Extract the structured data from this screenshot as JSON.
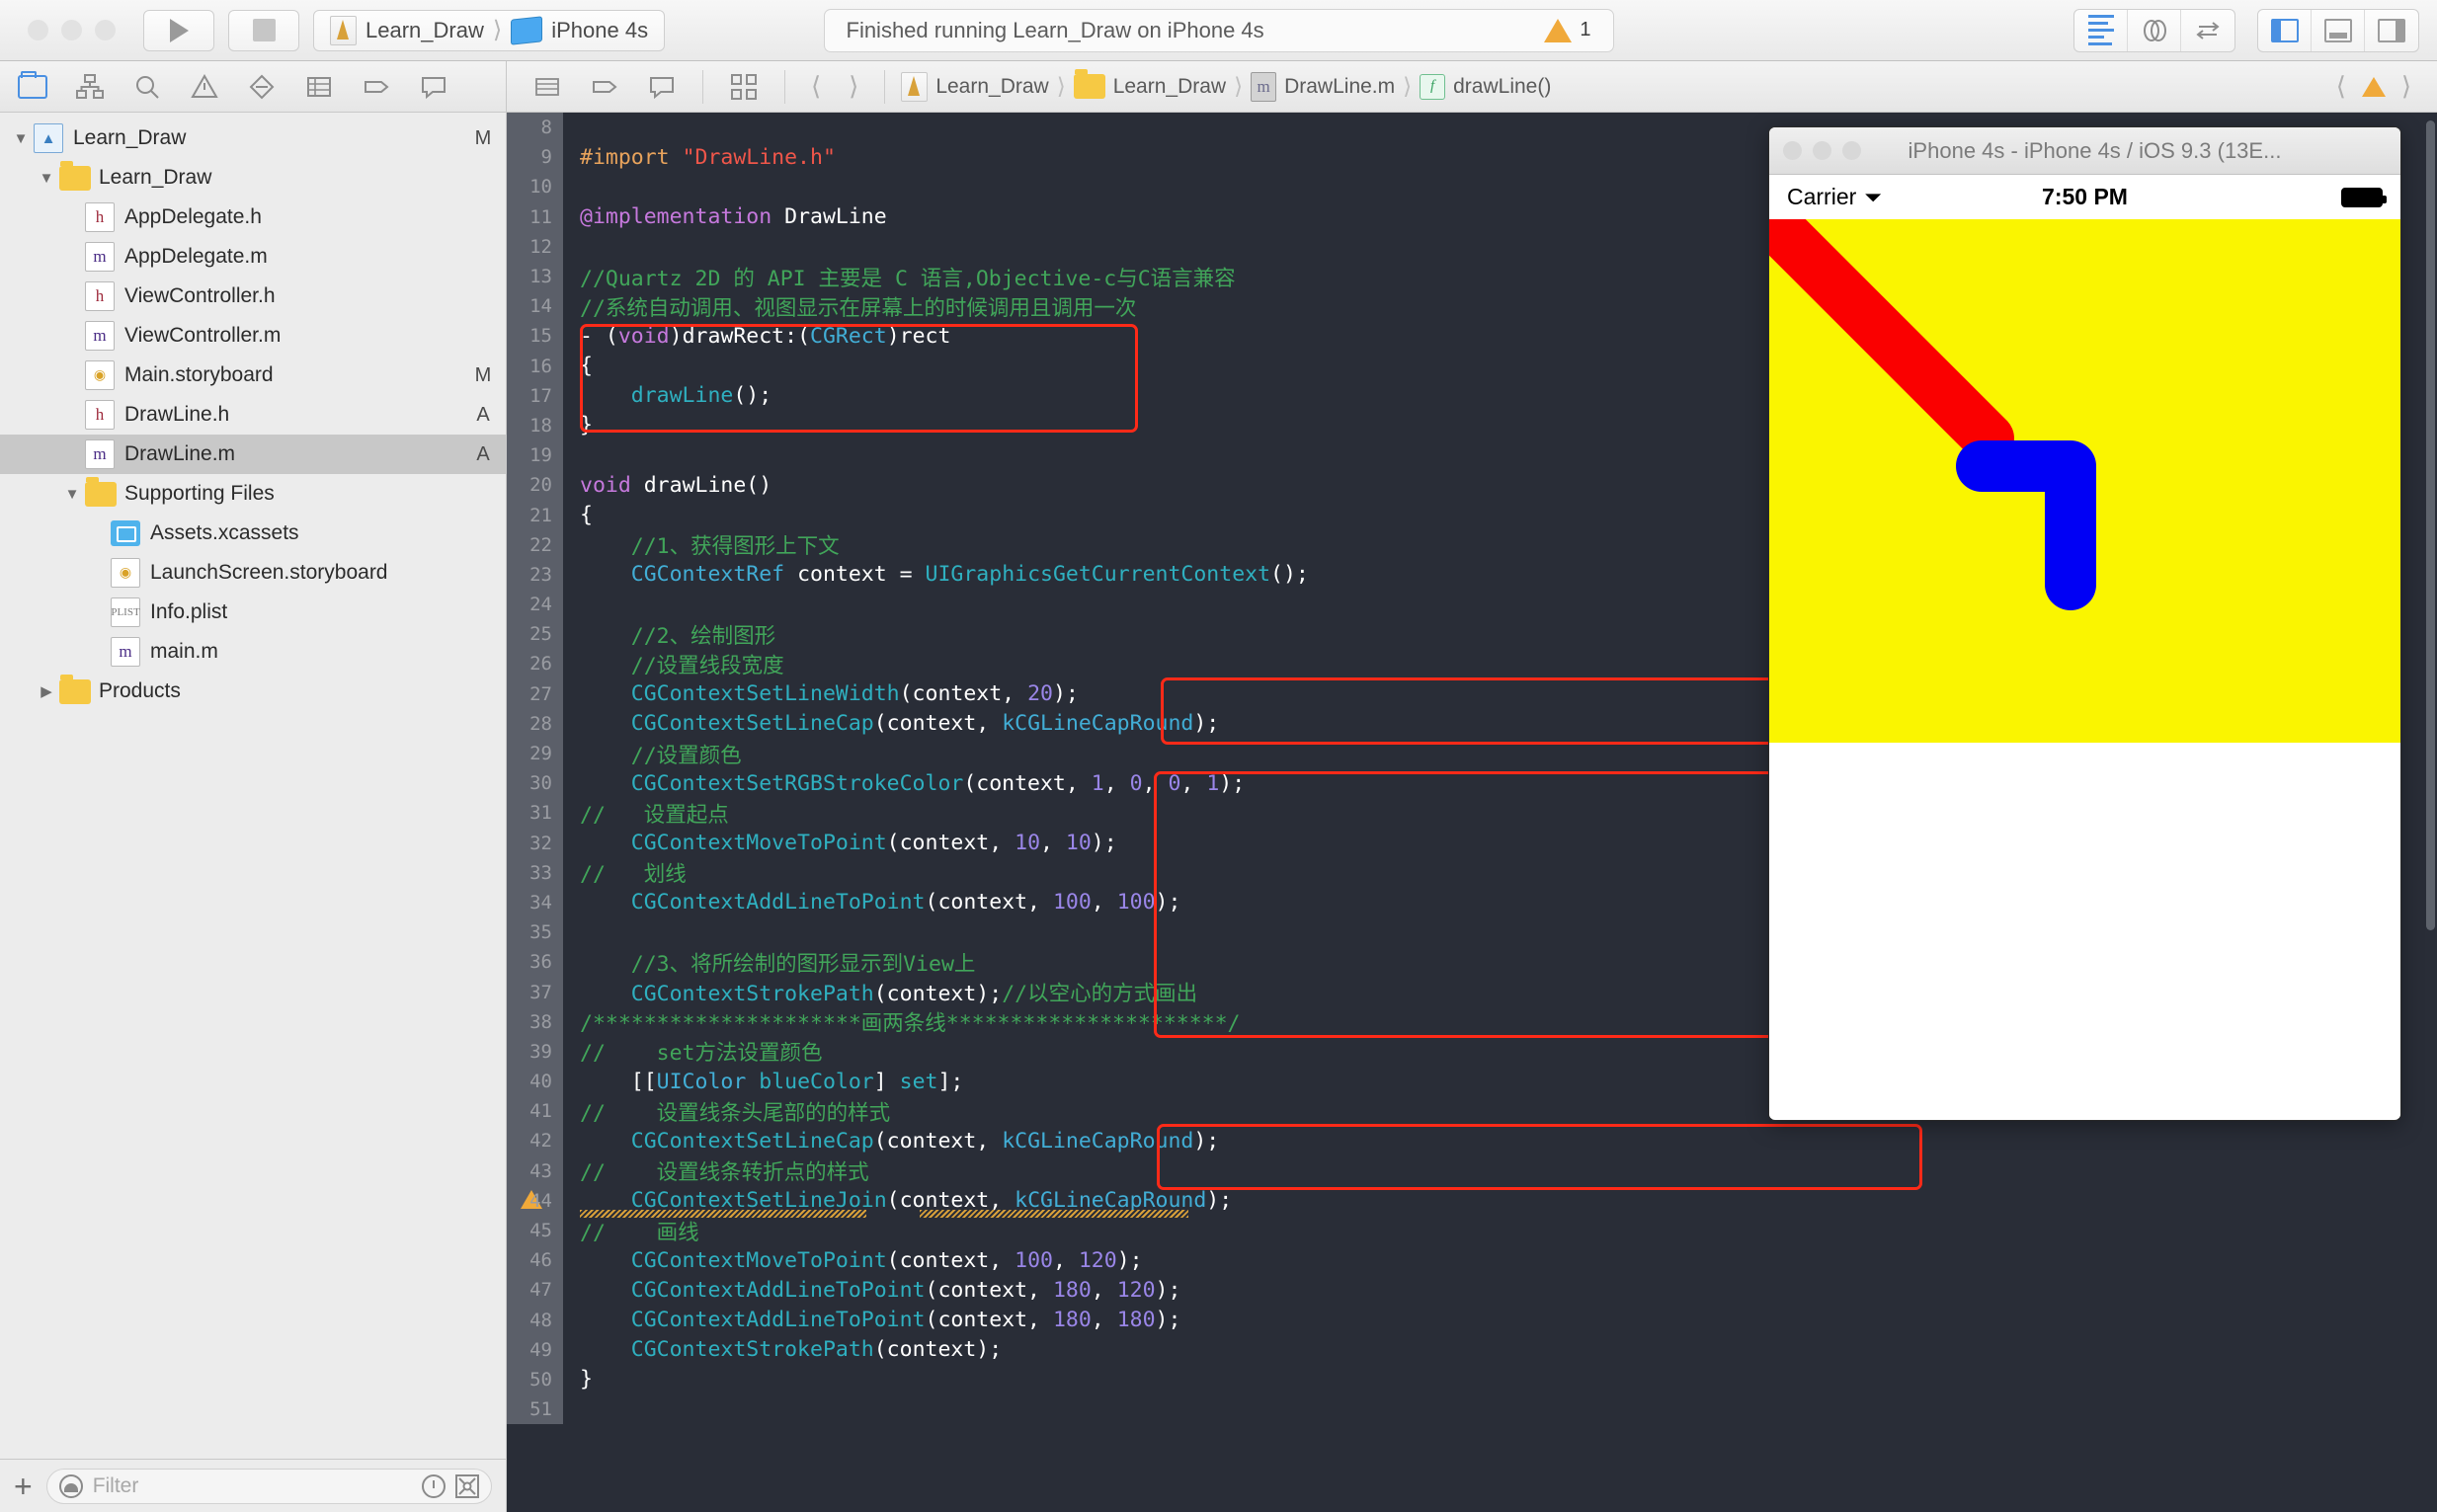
{
  "toolbar": {
    "run_label": "run-button",
    "stop_label": "stop-button",
    "scheme_project": "Learn_Draw",
    "scheme_device": "iPhone 4s",
    "status_text": "Finished running Learn_Draw on iPhone 4s",
    "warning_count": "1"
  },
  "navigator": {
    "filter_placeholder": "Filter",
    "tree": [
      {
        "label": "Learn_Draw",
        "indent": 0,
        "icon": "project-icon",
        "twisty": "open",
        "status": "M"
      },
      {
        "label": "Learn_Draw",
        "indent": 1,
        "icon": "folder-icon",
        "twisty": "open",
        "status": ""
      },
      {
        "label": "AppDelegate.h",
        "indent": 2,
        "icon": "header-file-icon",
        "twisty": "",
        "status": ""
      },
      {
        "label": "AppDelegate.m",
        "indent": 2,
        "icon": "source-file-icon",
        "twisty": "",
        "status": ""
      },
      {
        "label": "ViewController.h",
        "indent": 2,
        "icon": "header-file-icon",
        "twisty": "",
        "status": ""
      },
      {
        "label": "ViewController.m",
        "indent": 2,
        "icon": "source-file-icon",
        "twisty": "",
        "status": ""
      },
      {
        "label": "Main.storyboard",
        "indent": 2,
        "icon": "storyboard-icon",
        "twisty": "",
        "status": "M"
      },
      {
        "label": "DrawLine.h",
        "indent": 2,
        "icon": "header-file-icon",
        "twisty": "",
        "status": "A"
      },
      {
        "label": "DrawLine.m",
        "indent": 2,
        "icon": "source-file-icon",
        "twisty": "",
        "status": "A",
        "selected": true
      },
      {
        "label": "Supporting Files",
        "indent": 2,
        "icon": "folder-icon",
        "twisty": "open",
        "status": ""
      },
      {
        "label": "Assets.xcassets",
        "indent": 3,
        "icon": "assets-icon",
        "twisty": "",
        "status": ""
      },
      {
        "label": "LaunchScreen.storyboard",
        "indent": 3,
        "icon": "storyboard-icon",
        "twisty": "",
        "status": ""
      },
      {
        "label": "Info.plist",
        "indent": 3,
        "icon": "plist-icon",
        "twisty": "",
        "status": ""
      },
      {
        "label": "main.m",
        "indent": 3,
        "icon": "source-file-icon",
        "twisty": "",
        "status": ""
      },
      {
        "label": "Products",
        "indent": 1,
        "icon": "folder-icon",
        "twisty": "closed",
        "status": ""
      }
    ]
  },
  "jumpbar": {
    "crumbs": [
      "Learn_Draw",
      "Learn_Draw",
      "DrawLine.m",
      "drawLine()"
    ]
  },
  "editor": {
    "lines": [
      {
        "n": "8",
        "html": ""
      },
      {
        "n": "9",
        "html": "<span class='pre'>#import</span> <span class='str'>\"DrawLine.h\"</span>"
      },
      {
        "n": "10",
        "html": ""
      },
      {
        "n": "11",
        "html": "<span class='kw'>@implementation</span> <span class='cls'>DrawLine</span>"
      },
      {
        "n": "12",
        "html": ""
      },
      {
        "n": "13",
        "html": "<span class='cm'>//Quartz 2D 的 API 主要是 C 语言,Objective-c与C语言兼容</span>"
      },
      {
        "n": "14",
        "html": "<span class='cm'>//系统自动调用、视图显示在屏幕上的时候调用且调用一次</span>"
      },
      {
        "n": "15",
        "html": "<span class='pl'>- (</span><span class='kw'>void</span><span class='pl'>)drawRect:(</span><span class='ty'>CGRect</span><span class='pl'>)rect</span>"
      },
      {
        "n": "16",
        "html": "<span class='pl'>{</span>"
      },
      {
        "n": "17",
        "html": "    <span class='fn'>drawLine</span><span class='pl'>();</span>"
      },
      {
        "n": "18",
        "html": "<span class='pl'>}</span>"
      },
      {
        "n": "19",
        "html": ""
      },
      {
        "n": "20",
        "html": "<span class='kw'>void</span> <span class='pl'>drawLine()</span>"
      },
      {
        "n": "21",
        "html": "<span class='pl'>{</span>"
      },
      {
        "n": "22",
        "html": "    <span class='cm'>//1、获得图形上下文</span>"
      },
      {
        "n": "23",
        "html": "    <span class='ty'>CGContextRef</span> <span class='pl'>context = </span><span class='fn'>UIGraphicsGetCurrentContext</span><span class='pl'>();</span>"
      },
      {
        "n": "24",
        "html": ""
      },
      {
        "n": "25",
        "html": "    <span class='cm'>//2、绘制图形</span>"
      },
      {
        "n": "26",
        "html": "    <span class='cm'>//设置线段宽度</span>"
      },
      {
        "n": "27",
        "html": "    <span class='fn'>CGContextSetLineWidth</span><span class='pl'>(context, </span><span class='num'>20</span><span class='pl'>);</span>"
      },
      {
        "n": "28",
        "html": "    <span class='fn'>CGContextSetLineCap</span><span class='pl'>(context, </span><span class='ty'>kCGLineCapRound</span><span class='pl'>);</span>"
      },
      {
        "n": "29",
        "html": "    <span class='cm'>//设置颜色</span>"
      },
      {
        "n": "30",
        "html": "    <span class='fn'>CGContextSetRGBStrokeColor</span><span class='pl'>(context, </span><span class='num'>1</span><span class='pl'>, </span><span class='num'>0</span><span class='pl'>, </span><span class='num'>0</span><span class='pl'>, </span><span class='num'>1</span><span class='pl'>);</span>"
      },
      {
        "n": "31",
        "html": "<span class='cm'>//   设置起点</span>"
      },
      {
        "n": "32",
        "html": "    <span class='fn'>CGContextMoveToPoint</span><span class='pl'>(context, </span><span class='num'>10</span><span class='pl'>, </span><span class='num'>10</span><span class='pl'>);</span>"
      },
      {
        "n": "33",
        "html": "<span class='cm'>//   划线</span>"
      },
      {
        "n": "34",
        "html": "    <span class='fn'>CGContextAddLineToPoint</span><span class='pl'>(context, </span><span class='num'>100</span><span class='pl'>, </span><span class='num'>100</span><span class='pl'>);</span>"
      },
      {
        "n": "35",
        "html": ""
      },
      {
        "n": "36",
        "html": "    <span class='cm'>//3、将所绘制的图形显示到View上</span>"
      },
      {
        "n": "37",
        "html": "    <span class='fn'>CGContextStrokePath</span><span class='pl'>(context);</span><span class='cm'>//以空心的方式画出</span>"
      },
      {
        "n": "38",
        "html": "<span class='cm'>/*********************画两条线**********************/</span>"
      },
      {
        "n": "39",
        "html": "<span class='cm'>//    set方法设置颜色</span>"
      },
      {
        "n": "40",
        "html": "    <span class='pl'>[[</span><span class='ty'>UIColor</span> <span class='fn'>blueColor</span><span class='pl'>] </span><span class='fn'>set</span><span class='pl'>];</span>"
      },
      {
        "n": "41",
        "html": "<span class='cm'>//    设置线条头尾部的的样式</span>"
      },
      {
        "n": "42",
        "html": "    <span class='fn'>CGContextSetLineCap</span><span class='pl'>(context, </span><span class='ty'>kCGLineCapRound</span><span class='pl'>);</span>"
      },
      {
        "n": "43",
        "html": "<span class='cm'>//    设置线条转折点的样式</span>"
      },
      {
        "n": "44",
        "html": "    <span class='fn'>CGContextSetLineJoin</span><span class='pl'>(context, </span><span class='ty'>kCGLineCapRound</span><span class='pl'>);</span>",
        "warning": true
      },
      {
        "n": "45",
        "html": "<span class='cm'>//    画线</span>"
      },
      {
        "n": "46",
        "html": "    <span class='fn'>CGContextMoveToPoint</span><span class='pl'>(context, </span><span class='num'>100</span><span class='pl'>, </span><span class='num'>120</span><span class='pl'>);</span>"
      },
      {
        "n": "47",
        "html": "    <span class='fn'>CGContextAddLineToPoint</span><span class='pl'>(context, </span><span class='num'>180</span><span class='pl'>, </span><span class='num'>120</span><span class='pl'>);</span>"
      },
      {
        "n": "48",
        "html": "    <span class='fn'>CGContextAddLineToPoint</span><span class='pl'>(context, </span><span class='num'>180</span><span class='pl'>, </span><span class='num'>180</span><span class='pl'>);</span>"
      },
      {
        "n": "49",
        "html": "    <span class='fn'>CGContextStrokePath</span><span class='pl'>(context);</span>"
      },
      {
        "n": "50",
        "html": "<span class='pl'>}</span>"
      },
      {
        "n": "51",
        "html": ""
      }
    ]
  },
  "simulator": {
    "window_title": "iPhone 4s - iPhone 4s / iOS 9.3 (13E...",
    "carrier": "Carrier",
    "time": "7:50 PM",
    "canvas_bg": "#faf500",
    "red_stroke": "#fa0000",
    "blue_stroke": "#0000f5"
  }
}
